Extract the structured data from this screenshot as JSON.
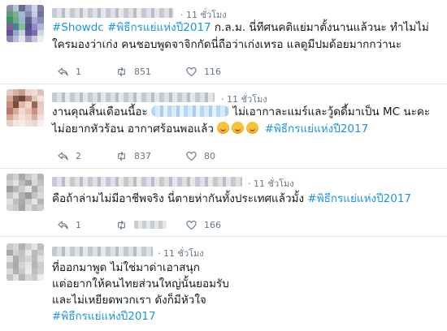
{
  "tweets": [
    {
      "time": "11 ชั่วโมง",
      "text_tag": "#Showdc #พิธีกรแย่แห่งปี2017",
      "text_rest": "ก.ล.ม. นี่ทีศนคติแย่มาตั้งนานแล้วนะ ทำไมไม่ใครมองว่าเก่ง คนชอบพูดจาจิกกัดนี่ถือว่าเก่งเหรอ แลดูมีปมด้อยมากกว่านะ",
      "replies": "1",
      "retweets": "851",
      "likes": "116",
      "avatar_colors": [
        "#8f8fa8",
        "#b7c2d6",
        "#6a6b86",
        "#9aa3c6",
        "#cdd5e6",
        "#7c7fa5",
        "#5e9a7a",
        "#7bb38a",
        "#a1b7d9",
        "#8a84b0",
        "#c4cbe2",
        "#6f7498",
        "#3f8f63",
        "#6ca97c",
        "#9fb5d6",
        "#5d5f86",
        "#b0a6d4",
        "#888fb5",
        "#7f5f9a",
        "#4c7d9c",
        "#7cc28a",
        "#52508a",
        "#9b86c7",
        "#adb7d1",
        "#6b4e9b",
        "#9aa7c8",
        "#c6cfe0",
        "#5f5993",
        "#7a6db1",
        "#d1d6e4",
        "#8a8aad",
        "#b6bfd6",
        "#dfe3ec",
        "#9b97c1",
        "#c4c9dc",
        "#e9ecf2"
      ]
    },
    {
      "time": "11 ชั่วโมง",
      "text_pre": "งานคุณสิ้นเดือนนี้อะ",
      "text_mid": "ไม่เอากาละแมร์และวู้ดดี้มาเป็น MC นะคะไม่อยากหัวร้อน อากาศร้อนพอแล้ว",
      "text_tag": "#พิธีกรแย่แห่งปี2017",
      "replies": "2",
      "retweets": "837",
      "likes": "80",
      "avatar_colors": [
        "#e4c8bf",
        "#d6b0a4",
        "#c49a8c",
        "#e8d2ca",
        "#f0ddd6",
        "#e2c0b6",
        "#d7a898",
        "#8a5b4e",
        "#6f463c",
        "#b98576",
        "#e3c6bd",
        "#f2e3dd",
        "#c88c7a",
        "#7a4b3f",
        "#e0b8a8",
        "#efd6cb",
        "#9a6656",
        "#e7cabf",
        "#b27a68",
        "#d9a897",
        "#f1d9cf",
        "#e6c1b2",
        "#c7927f",
        "#ead0c5",
        "#d5a794",
        "#e9c9bb",
        "#f3e0d8",
        "#efd4c9",
        "#d9b2a3",
        "#efe0da",
        "#e6cfc5",
        "#f2e5df",
        "#f6ece8",
        "#f0e1da",
        "#ead9d1",
        "#f7efeb"
      ]
    },
    {
      "time": "11 ชั่วโมง",
      "text_pre": "คือถ้าล่ามไม่มีอาชีพจริง นี่ตายห่ากันทั้งประเทศแล้วมั้ง",
      "text_tag": "#พิธีกรแย่แห่งปี2017",
      "replies": "1",
      "retweets": "",
      "likes": "166",
      "avatar_colors": [
        "#bfbfbf",
        "#d2d2d2",
        "#a9a9a9",
        "#c8c8c8",
        "#dcdcdc",
        "#b4b4b4",
        "#cfcfcf",
        "#e2e2e2",
        "#bcbcbc",
        "#a2a2a2",
        "#d7d7d7",
        "#c1c1c1",
        "#9d9d9d",
        "#b8b8b8",
        "#cdcdcd",
        "#e6e6e6",
        "#aaaaaa",
        "#d0d0d0",
        "#c6c6c6",
        "#dedede",
        "#b1b1b1",
        "#999999",
        "#c3c3c3",
        "#d9d9d9",
        "#e0e0e0",
        "#bdbdbd",
        "#ababab",
        "#cacaca",
        "#e4e4e4",
        "#b6b6b6",
        "#d4d4d4",
        "#c9c9c9",
        "#a6a6a6",
        "#dadada",
        "#bfbfbf",
        "#cccccc"
      ]
    },
    {
      "time": "11 ชั่วโมง",
      "line1": "ที่ออกมาพูด ไม่ใช่มาด่าเอาสนุก",
      "line2": "แต่อยากให้คนไทยส่วนใหญ่นั้นยอมรับ",
      "line3": "และไม่เหยียดพวกเรา ดังก็มีหัวใจ",
      "text_tag": "#พิธีกรแย่แห่งปี2017",
      "avatar_colors": [
        "#c9c9c9",
        "#d8d8d8",
        "#b3b3b3",
        "#cfcfcf",
        "#e3e3e3",
        "#bdbdbd",
        "#a7a7a7",
        "#d1d1d1",
        "#c2c2c2",
        "#e8e8e8",
        "#b9b9b9",
        "#cbcbcb",
        "#dedede",
        "#adadad",
        "#c6c6c6",
        "#d5d5d5",
        "#bababa",
        "#e0e0e0",
        "#c0c0c0",
        "#a9a9a9",
        "#d3d3d3",
        "#e5e5e5",
        "#b6b6b6",
        "#cdcdcd",
        "#dcdcdc",
        "#b0b0b0",
        "#c8c8c8",
        "#eaeaea",
        "#bfbfbf",
        "#d0d0d0",
        "#c4c4c4",
        "#e1e1e1",
        "#b4b4b4",
        "#d6d6d6",
        "#cacaca",
        "#ededed"
      ]
    }
  ],
  "colors": {
    "hashtag": "#1b95e0",
    "meta": "#657786",
    "divider": "#e1e8ed"
  },
  "icons": [
    "reply-icon",
    "retweet-icon",
    "like-icon"
  ]
}
